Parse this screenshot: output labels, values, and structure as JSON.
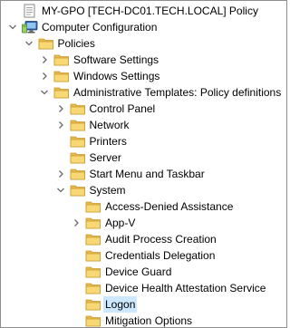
{
  "tree": {
    "nodes": [
      {
        "id": "root-gpo",
        "label": "MY-GPO [TECH-DC01.TECH.LOCAL] Policy",
        "level": 0,
        "expander": "none",
        "icon": "policy-document-icon",
        "selected": false
      },
      {
        "id": "computer-configuration",
        "label": "Computer Configuration",
        "level": 0,
        "expander": "expanded",
        "icon": "computer-icon",
        "selected": false
      },
      {
        "id": "policies",
        "label": "Policies",
        "level": 1,
        "expander": "expanded",
        "icon": "folder-icon",
        "selected": false
      },
      {
        "id": "software-settings",
        "label": "Software Settings",
        "level": 2,
        "expander": "collapsed",
        "icon": "folder-icon",
        "selected": false
      },
      {
        "id": "windows-settings",
        "label": "Windows Settings",
        "level": 2,
        "expander": "collapsed",
        "icon": "folder-icon",
        "selected": false
      },
      {
        "id": "administrative-templates",
        "label": "Administrative Templates: Policy definitions",
        "level": 2,
        "expander": "expanded",
        "icon": "folder-icon",
        "selected": false
      },
      {
        "id": "control-panel",
        "label": "Control Panel",
        "level": 3,
        "expander": "collapsed",
        "icon": "folder-icon",
        "selected": false
      },
      {
        "id": "network",
        "label": "Network",
        "level": 3,
        "expander": "collapsed",
        "icon": "folder-icon",
        "selected": false
      },
      {
        "id": "printers",
        "label": "Printers",
        "level": 3,
        "expander": "none",
        "icon": "folder-icon",
        "selected": false
      },
      {
        "id": "server",
        "label": "Server",
        "level": 3,
        "expander": "none",
        "icon": "folder-icon",
        "selected": false
      },
      {
        "id": "start-menu-taskbar",
        "label": "Start Menu and Taskbar",
        "level": 3,
        "expander": "collapsed",
        "icon": "folder-icon",
        "selected": false
      },
      {
        "id": "system",
        "label": "System",
        "level": 3,
        "expander": "expanded",
        "icon": "folder-icon",
        "selected": false
      },
      {
        "id": "access-denied-assistance",
        "label": "Access-Denied Assistance",
        "level": 4,
        "expander": "none",
        "icon": "folder-icon",
        "selected": false
      },
      {
        "id": "app-v",
        "label": "App-V",
        "level": 4,
        "expander": "collapsed",
        "icon": "folder-icon",
        "selected": false
      },
      {
        "id": "audit-process-creation",
        "label": "Audit Process Creation",
        "level": 4,
        "expander": "none",
        "icon": "folder-icon",
        "selected": false
      },
      {
        "id": "credentials-delegation",
        "label": "Credentials Delegation",
        "level": 4,
        "expander": "none",
        "icon": "folder-icon",
        "selected": false
      },
      {
        "id": "device-guard",
        "label": "Device Guard",
        "level": 4,
        "expander": "none",
        "icon": "folder-icon",
        "selected": false
      },
      {
        "id": "device-health-attestation",
        "label": "Device Health Attestation Service",
        "level": 4,
        "expander": "none",
        "icon": "folder-icon",
        "selected": false
      },
      {
        "id": "logon",
        "label": "Logon",
        "level": 4,
        "expander": "none",
        "icon": "folder-icon",
        "selected": true
      },
      {
        "id": "mitigation-options",
        "label": "Mitigation Options",
        "level": 4,
        "expander": "none",
        "icon": "folder-icon",
        "selected": false
      }
    ]
  },
  "colors": {
    "folder_fill": "#f8d775",
    "folder_tab": "#e8b84a",
    "folder_edge": "#c99a2e",
    "expander_glyph": "#6b6b6b",
    "selection_background": "#cce8ff",
    "panel_border": "#8e8e8e"
  }
}
